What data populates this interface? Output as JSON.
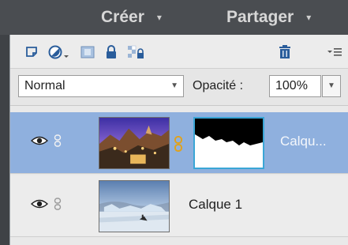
{
  "header": {
    "menus": [
      {
        "label": "Créer",
        "caret": "▾"
      },
      {
        "label": "Partager",
        "caret": "▾"
      }
    ]
  },
  "toolbar": {
    "icons": [
      "new-layer-icon",
      "adjustment-layer-icon",
      "add-mask-icon",
      "lock-all-icon",
      "lock-transparency-icon",
      "delete-icon",
      "panel-menu-icon"
    ]
  },
  "layer_options": {
    "blend_mode": "Normal",
    "opacity_label": "Opacité :",
    "opacity_value": "100%"
  },
  "layers": [
    {
      "name": "Calqu...",
      "selected": true,
      "has_mask": true
    },
    {
      "name": "Calque 1",
      "selected": false,
      "has_mask": false
    }
  ],
  "colors": {
    "selected_row": "#8fb0de",
    "panel_bg": "#e9e9e9",
    "topbar_bg": "#4a4d51",
    "mask_border": "#3aa6d6"
  }
}
